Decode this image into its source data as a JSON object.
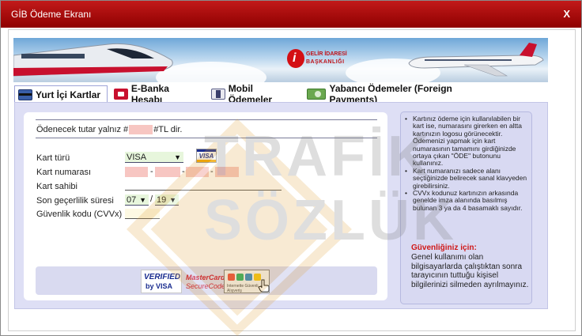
{
  "window": {
    "title": "GİB Ödeme Ekranı",
    "close_label": "X"
  },
  "banner": {
    "logo_line1": "GELİR İDARESİ",
    "logo_line2": "BAŞKANLIĞI"
  },
  "tabs": [
    {
      "label": "Yurt İçi Kartlar",
      "icon": "credit-card-icon",
      "active": true
    },
    {
      "label": "E-Banka Hesabı",
      "icon": "bank-lock-icon",
      "active": false
    },
    {
      "label": "Mobil Ödemeler",
      "icon": "mobile-payment-icon",
      "active": false
    },
    {
      "label": "Yabancı Ödemeler (Foreign Payments)",
      "icon": "foreign-payment-icon",
      "active": false
    }
  ],
  "form": {
    "amount_prefix": "Ödenecek tutar yalnız #",
    "amount_suffix": "#TL dir.",
    "card_type_label": "Kart türü",
    "card_type_value": "VISA",
    "card_badge": "VISA",
    "card_number_label": "Kart numarası",
    "card_number_separator": "-",
    "card_holder_label": "Kart sahibi",
    "expiry_label": "Son geçerlilik süresi",
    "expiry_month": "07",
    "expiry_year": "19",
    "expiry_separator": "/",
    "cvv_label": "Güvenlik kodu (CVVx)"
  },
  "badges": {
    "verified_line1": "VERIFIED",
    "verified_line2": "by VISA",
    "mastercard_line1": "MasterCard.",
    "mastercard_line2": "SecureCode.",
    "troy_text": "Internette Güvenli Alışveriş"
  },
  "info": {
    "bullets": [
      "Kartınız ödeme için kullanılabilen bir kart ise, numarasını girerken en altta kartınızın logosu görünecektir. Ödemenizi yapmak için kart numarasının tamamını girdiğinizde ortaya çıkan \"ÖDE\" butonunu kullanınız.",
      "Kart numaranızı sadece alanı seçtiğinizde belirecek sanal klavyeden girebilirsiniz.",
      "CVVx kodunuz kartınızın arkasında genelde imza alanında basılmış bulunan 3 ya da 4 basamaklı sayıdır."
    ],
    "security_title": "Güvenliğiniz için:",
    "security_text": "Genel kullanımı olan bilgisayarlarda çalıştıktan sonra tarayıcının tuttuğu kişisel bilgilerinizi silmeden ayrılmayınız."
  },
  "watermark": {
    "line1": "TRAFİK",
    "line2": "SÖZLÜK"
  },
  "colors": {
    "titlebar": "#b01212",
    "panel_bg": "#dedff5",
    "field_pink": "#f7c6c2",
    "security_red": "#d01818"
  }
}
